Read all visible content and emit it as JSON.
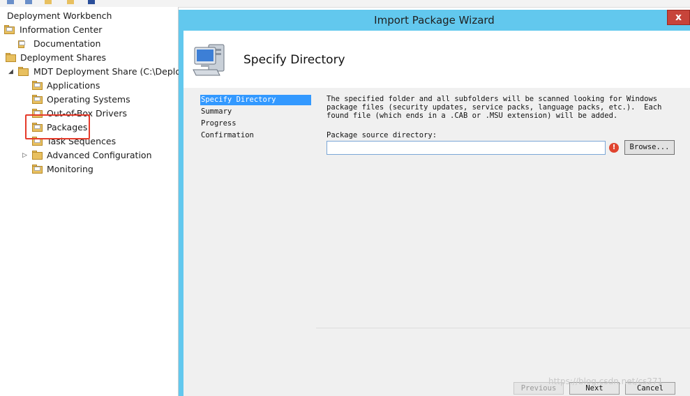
{
  "tree": {
    "root": "Deployment Workbench",
    "items": [
      {
        "label": "Information Center",
        "expanded": true
      },
      {
        "label": "Documentation"
      },
      {
        "label": "Deployment Shares",
        "expanded": true
      },
      {
        "label": "MDT Deployment Share (C:\\Deployr",
        "expanded": true
      },
      {
        "label": "Applications"
      },
      {
        "label": "Operating Systems"
      },
      {
        "label": "Out-of-Box Drivers"
      },
      {
        "label": "Packages",
        "highlighted": true
      },
      {
        "label": "Task Sequences"
      },
      {
        "label": "Advanced Configuration",
        "expandable": true
      },
      {
        "label": "Monitoring"
      }
    ],
    "expanded_arrow": "◢",
    "collapsed_arrow": "▷"
  },
  "wizard": {
    "title": "Import Package Wizard",
    "close_label": "x",
    "header_title": "Specify Directory",
    "steps": [
      "Specify Directory",
      "Summary",
      "Progress",
      "Confirmation"
    ],
    "active_step": "Specify Directory",
    "description": "The specified folder and all subfolders will be scanned looking for Windows\npackage files (security updates, service packs, language packs, etc.).  Each\nfound file (which ends in a .CAB or .MSU extension) will be added.",
    "source_label": "Package source directory:",
    "source_value": "",
    "error_icon": "!",
    "browse_label": "Browse...",
    "previous_label": "Previous",
    "next_label": "Next",
    "cancel_label": "Cancel"
  },
  "watermark": "https://blog.csdn.net/cs271",
  "colors": {
    "titlebar": "#62c8ee",
    "highlight_box": "#e53a2a",
    "active_step": "#3399ff",
    "close_button": "#c7443a"
  }
}
